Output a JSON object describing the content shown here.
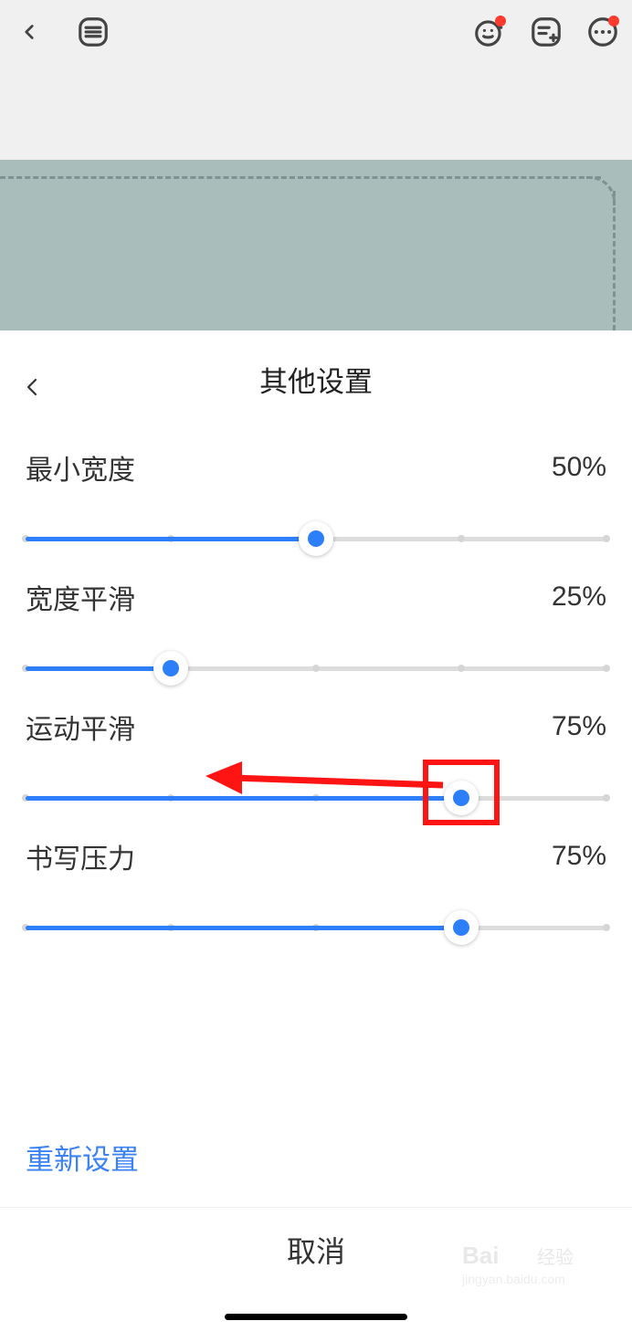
{
  "panel": {
    "title": "其他设置",
    "reset_label": "重新设置",
    "rows": [
      {
        "label": "最小宽度",
        "value": 50
      },
      {
        "label": "宽度平滑",
        "value": 25
      },
      {
        "label": "运动平滑",
        "value": 75
      },
      {
        "label": "书写压力",
        "value": 75
      }
    ]
  },
  "cancel_label": "取消",
  "watermark": {
    "brand": "Bai",
    "brand2": "经验",
    "url": "jingyan.baidu.com"
  },
  "annotations": {
    "arrow_target_row": 2,
    "box_target_row": 2
  }
}
